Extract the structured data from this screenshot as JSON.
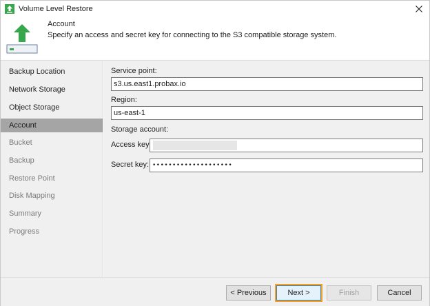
{
  "window": {
    "title": "Volume Level Restore",
    "accent_color": "#36a84b"
  },
  "header": {
    "title": "Account",
    "description": "Specify an access and secret key for connecting to the S3 compatible storage system.",
    "icon": "upload-arrow-icon"
  },
  "sidebar": {
    "items": [
      {
        "label": "Backup Location",
        "state": "done"
      },
      {
        "label": "Network Storage",
        "state": "done"
      },
      {
        "label": "Object Storage",
        "state": "done"
      },
      {
        "label": "Account",
        "state": "active"
      },
      {
        "label": "Bucket",
        "state": "pending"
      },
      {
        "label": "Backup",
        "state": "pending"
      },
      {
        "label": "Restore Point",
        "state": "pending"
      },
      {
        "label": "Disk Mapping",
        "state": "pending"
      },
      {
        "label": "Summary",
        "state": "pending"
      },
      {
        "label": "Progress",
        "state": "pending"
      }
    ]
  },
  "form": {
    "service_point_label": "Service point:",
    "service_point_value": "s3.us.east1.probax.io",
    "region_label": "Region:",
    "region_value": "us-east-1",
    "storage_account_label": "Storage account:",
    "access_key_label": "Access key:",
    "secret_key_label": "Secret key:",
    "secret_key_value": "••••••••••••••••••••"
  },
  "footer": {
    "previous_label": "< Previous",
    "next_label": "Next >",
    "finish_label": "Finish",
    "cancel_label": "Cancel"
  }
}
